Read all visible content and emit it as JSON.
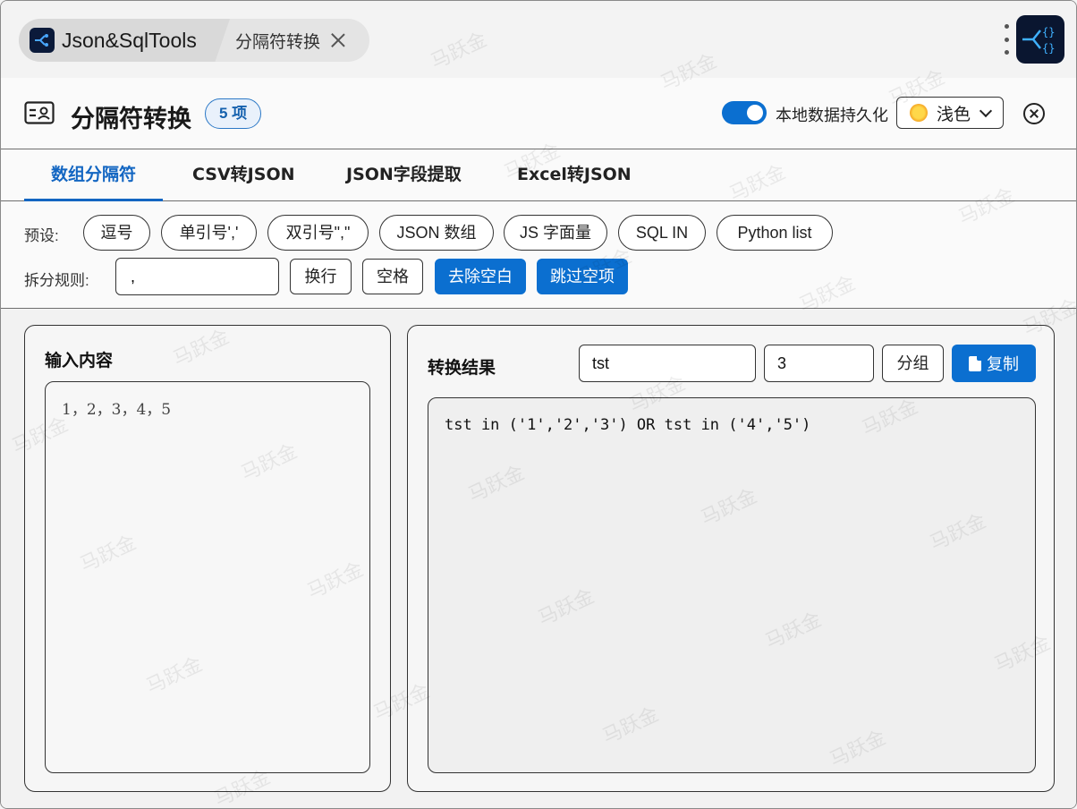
{
  "app": {
    "tab_title": "Json&SqlTools",
    "active_tool_tab": "分隔符转换"
  },
  "header": {
    "title": "分隔符转换",
    "count_badge": "5 项",
    "persist_label": "本地数据持久化",
    "persist_enabled": true,
    "theme_value": "浅色"
  },
  "tabs": [
    {
      "label": "数组分隔符",
      "active": true
    },
    {
      "label": "CSV转JSON",
      "active": false
    },
    {
      "label": "JSON字段提取",
      "active": false
    },
    {
      "label": "Excel转JSON",
      "active": false
    }
  ],
  "presets": {
    "label": "预设:",
    "items": [
      "逗号",
      "单引号','",
      "双引号\",\"",
      "JSON 数组",
      "JS 字面量",
      "SQL IN",
      "Python list"
    ]
  },
  "split_rule": {
    "label": "拆分规则:",
    "value": ",",
    "buttons": [
      {
        "label": "换行",
        "active": false
      },
      {
        "label": "空格",
        "active": false
      },
      {
        "label": "去除空白",
        "active": true
      },
      {
        "label": "跳过空项",
        "active": true
      }
    ]
  },
  "input_panel": {
    "title": "输入内容",
    "content": "1，2，3，4，5"
  },
  "result_panel": {
    "title": "转换结果",
    "field_value": "tst",
    "group_size": "3",
    "group_button": "分组",
    "copy_button": "复制",
    "output": "tst in ('1','2','3') OR tst in ('4','5')"
  },
  "watermark": "马跃金",
  "colors": {
    "accent": "#0b6fd0",
    "tab_active": "#1366c2"
  }
}
